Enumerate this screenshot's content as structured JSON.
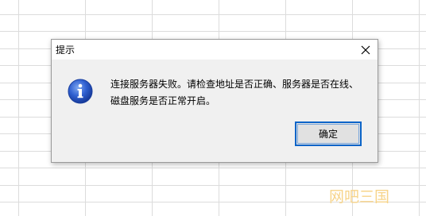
{
  "dialog": {
    "title": "提示",
    "message_line1": "连接服务器失败。请检查地址是否正确、服务器是否在线、",
    "message_line2": "磁盘服务是否正常开启。",
    "ok_label": "确定",
    "close_icon": "close-icon",
    "info_icon": "info-icon"
  },
  "watermark": "网吧三国",
  "colors": {
    "grid_line": "#d9d9d9",
    "dialog_bg": "#f0f0f0",
    "button_border": "#0a64c8",
    "info_blue": "#1f4fbf",
    "watermark": "#f7d48a"
  }
}
